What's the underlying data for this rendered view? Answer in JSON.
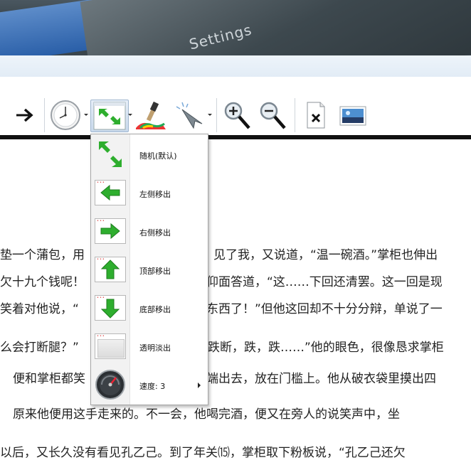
{
  "banner": {
    "title": "Settings"
  },
  "toolbar": {
    "items": [
      {
        "name": "arrow-right-icon"
      },
      {
        "name": "clock-icon"
      },
      {
        "name": "transition-icon"
      },
      {
        "name": "brush-icon"
      },
      {
        "name": "pointer-icon"
      },
      {
        "name": "zoom-in-icon"
      },
      {
        "name": "zoom-out-icon"
      },
      {
        "name": "close-document-icon"
      },
      {
        "name": "image-icon"
      }
    ]
  },
  "menu": {
    "items": [
      {
        "label": "随机(默认)",
        "icon": "random-transition-icon"
      },
      {
        "label": "左侧移出",
        "icon": "arrow-left-icon"
      },
      {
        "label": "右侧移出",
        "icon": "arrow-right-icon"
      },
      {
        "label": "顶部移出",
        "icon": "arrow-up-icon"
      },
      {
        "label": "底部移出",
        "icon": "arrow-down-icon"
      },
      {
        "label": "透明淡出",
        "icon": "fade-icon"
      },
      {
        "label": "速度: 3",
        "icon": "speedometer-icon"
      }
    ]
  },
  "text": {
    "l1a": "垫一个蒲包，用",
    "l1b": "见了我，又说道，“温一碗酒。”掌柜也伸出",
    "l2a": "欠十九个钱呢！",
    "l2b": "仰面答道，“这……下回还清罢。这一回是现",
    "l3a": "笑着对他说，“",
    "l3b": "东西了！”但他这回却不十分分辩，单说了一",
    "l4a": "么会打断腿？”",
    "l4b": "跌断，跌，跌……”他的眼色，很像恳求掌柜",
    "l5a": "便和掌柜都笑",
    "l5b": "端出去，放在门槛上。他从破衣袋里摸出四",
    "l6": "原来他便用这手走来的。不一会，他喝完酒，便又在旁人的说笑声中，坐",
    "l7": "以后，又长久没有看见孔乙己。到了年关⒂，掌柜取下粉板说，“孔乙己还欠"
  },
  "colors": {
    "green": "#2eae2e",
    "menu_border": "#a6a6a6"
  }
}
